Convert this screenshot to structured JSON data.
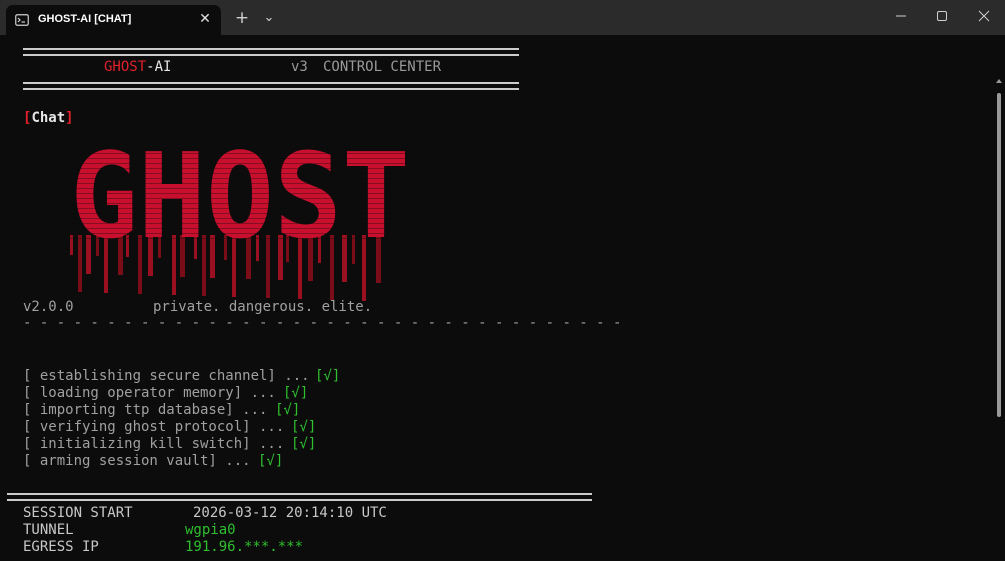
{
  "window": {
    "tab_title": "GHOST-AI [CHAT]",
    "tab_close_glyph": "✕",
    "new_tab_glyph": "+",
    "dropdown_glyph": "⌄"
  },
  "header": {
    "brand_red": "GHOST",
    "brand_rest": "-AI",
    "version_tag": "v3",
    "center_title": "CONTROL CENTER"
  },
  "mode": {
    "open_bracket": "[",
    "label": "Chat",
    "close_bracket": "]"
  },
  "banner": {
    "art_text": "GHOST",
    "color": "#c8102e",
    "version": "v2.0.0",
    "tagline": "private. dangerous. elite."
  },
  "boot_steps": [
    {
      "text": "[ establishing secure channel] ...",
      "status": "[√]"
    },
    {
      "text": "[ loading operator memory] ...",
      "status": "[√]"
    },
    {
      "text": "[ importing ttp database] ...",
      "status": "[√]"
    },
    {
      "text": "[ verifying ghost protocol] ...",
      "status": "[√]"
    },
    {
      "text": "[ initializing kill switch] ...",
      "status": "[√]"
    },
    {
      "text": "[ arming session vault] ...",
      "status": "[√]"
    }
  ],
  "session": {
    "start_label": "SESSION START",
    "start_value": "2026-03-12 20:14:10 UTC",
    "tunnel_label": "TUNNEL",
    "tunnel_value": "wgpia0",
    "egress_label": "EGRESS IP",
    "egress_value": "191.96.***.***"
  },
  "colors": {
    "accent_red": "#e0202a",
    "ok_green": "#2fbf2f",
    "background": "#0c0c0c",
    "titlebar": "#2b2b2b"
  }
}
